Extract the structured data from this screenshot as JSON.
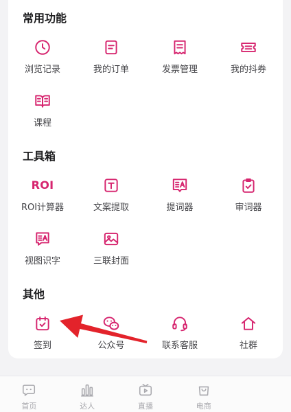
{
  "sections": [
    {
      "title": "常用功能",
      "items": [
        {
          "label": "浏览记录",
          "icon": "clock-icon"
        },
        {
          "label": "我的订单",
          "icon": "order-icon"
        },
        {
          "label": "发票管理",
          "icon": "invoice-icon"
        },
        {
          "label": "我的抖券",
          "icon": "coupon-icon"
        },
        {
          "label": "课程",
          "icon": "book-icon"
        }
      ]
    },
    {
      "title": "工具箱",
      "items": [
        {
          "label": "ROI计算器",
          "icon": "roi-icon",
          "icon_text": "ROI"
        },
        {
          "label": "文案提取",
          "icon": "text-extract-icon"
        },
        {
          "label": "提词器",
          "icon": "teleprompter-icon"
        },
        {
          "label": "审词器",
          "icon": "clipboard-check-icon"
        },
        {
          "label": "视图识字",
          "icon": "image-text-icon"
        },
        {
          "label": "三联封面",
          "icon": "image-icon"
        }
      ]
    },
    {
      "title": "其他",
      "items": [
        {
          "label": "签到",
          "icon": "calendar-check-icon"
        },
        {
          "label": "公众号",
          "icon": "wechat-icon"
        },
        {
          "label": "联系客服",
          "icon": "headset-icon"
        },
        {
          "label": "社群",
          "icon": "home-icon"
        }
      ]
    }
  ],
  "tabbar": [
    {
      "label": "首页",
      "icon": "chat-bubble-icon"
    },
    {
      "label": "达人",
      "icon": "bar-chart-icon"
    },
    {
      "label": "直播",
      "icon": "tv-play-icon"
    },
    {
      "label": "电商",
      "icon": "shopping-bag-icon"
    }
  ],
  "colors": {
    "accent": "#d6246e",
    "label": "#444448",
    "tab_inactive": "#a9a9ae",
    "background": "#f3f3f5",
    "annotation_arrow": "#e3232b"
  }
}
